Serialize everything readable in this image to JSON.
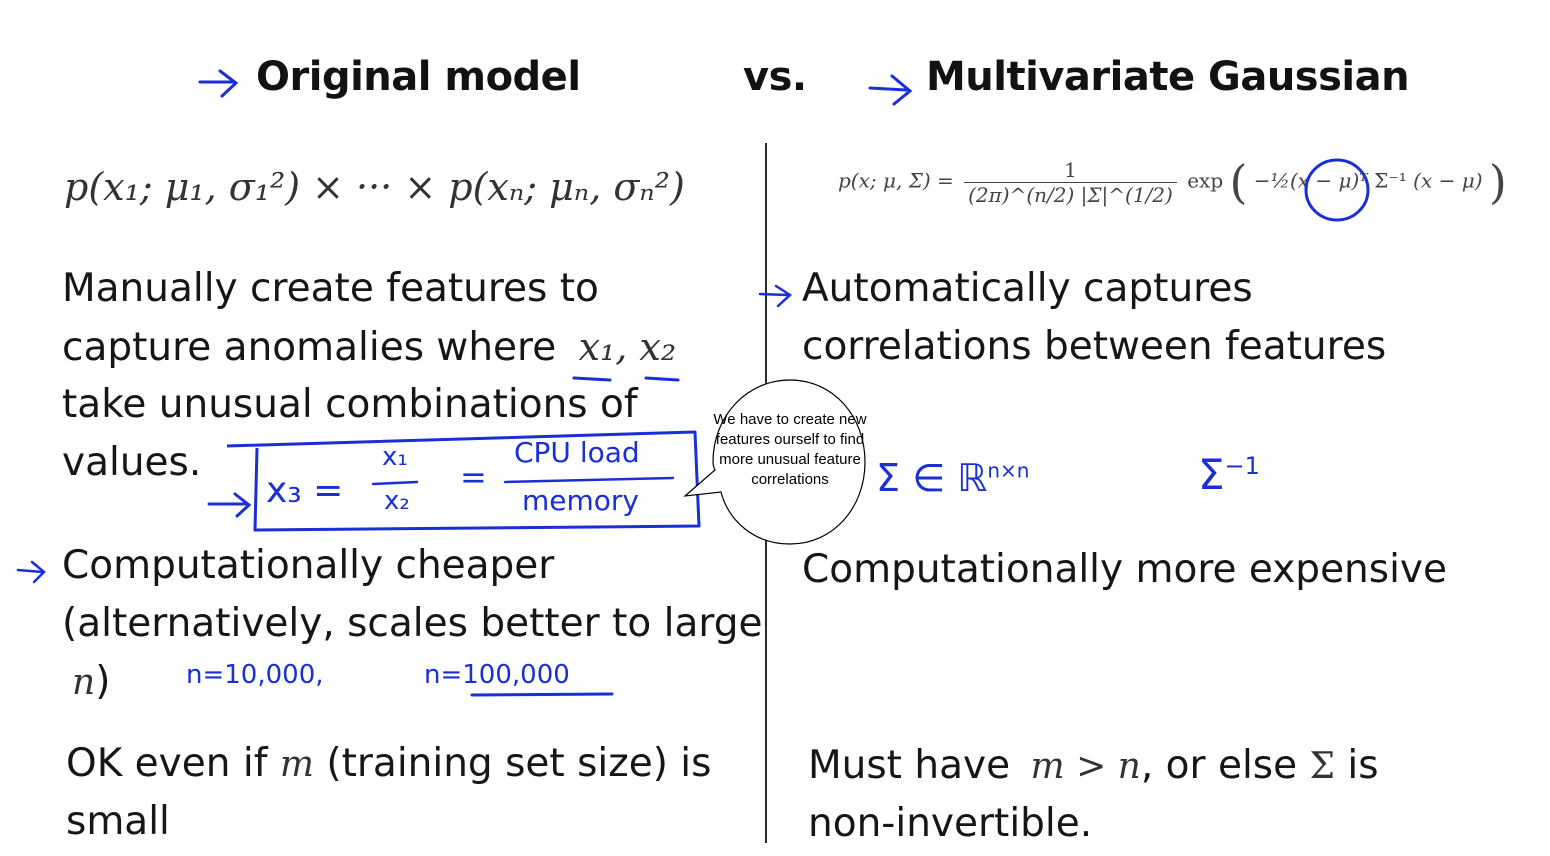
{
  "titles": {
    "left": "Original model",
    "vs": "vs.",
    "right": "Multivariate Gaussian"
  },
  "left": {
    "formula": "p(x₁; μ₁, σ₁²) × ··· × p(xₙ; μₙ, σₙ²)",
    "features_lines": [
      "Manually create features to",
      "capture anomalies where",
      "take unusual combinations of",
      "values."
    ],
    "features_vars": "x₁, x₂",
    "cheaper_lines": [
      "Computationally cheaper",
      "(alternatively, scales better to large"
    ],
    "cheaper_var": "n",
    "small_m_before": "OK even if",
    "small_m_var": "m",
    "small_m_after": "(training set size) is",
    "small_m_line2": "small"
  },
  "right": {
    "formula": {
      "lhs": "p(x; μ, Σ) =",
      "num": "1",
      "den": "(2π)^(n/2) |Σ|^(1/2)",
      "exp": "exp",
      "inner_a": "−½(x − μ)ᵀ",
      "inner_sigma": "Σ⁻¹",
      "inner_b": "(x − μ)"
    },
    "auto_lines": [
      "Automatically captures",
      "correlations between features"
    ],
    "expensive": "Computationally more expensive",
    "must_before": "Must have",
    "must_math": "m > n",
    "must_after": ", or else",
    "must_sigma": "Σ",
    "must_end": "is",
    "must_line2": "non-invertible."
  },
  "annotations": {
    "x3_lhs": "x₃ =",
    "x3_num": "x₁",
    "x3_den": "x₂",
    "x3_eq": "=",
    "cpu_num": "CPU load",
    "cpu_den": "memory",
    "n_small": "n=10,000,",
    "n_large": "n=100,000",
    "sigma_dim": "Σ ∈ ℝ",
    "sigma_dim_sup": "n×n",
    "sigma_inv": "Σ",
    "sigma_inv_sup": "−1"
  },
  "bubble": {
    "text": "We have to create new features ourself to find more unusual feature correlations"
  },
  "colors": {
    "ink": "#1a2fd6",
    "text": "#161616",
    "divider": "#2b2b2b"
  }
}
